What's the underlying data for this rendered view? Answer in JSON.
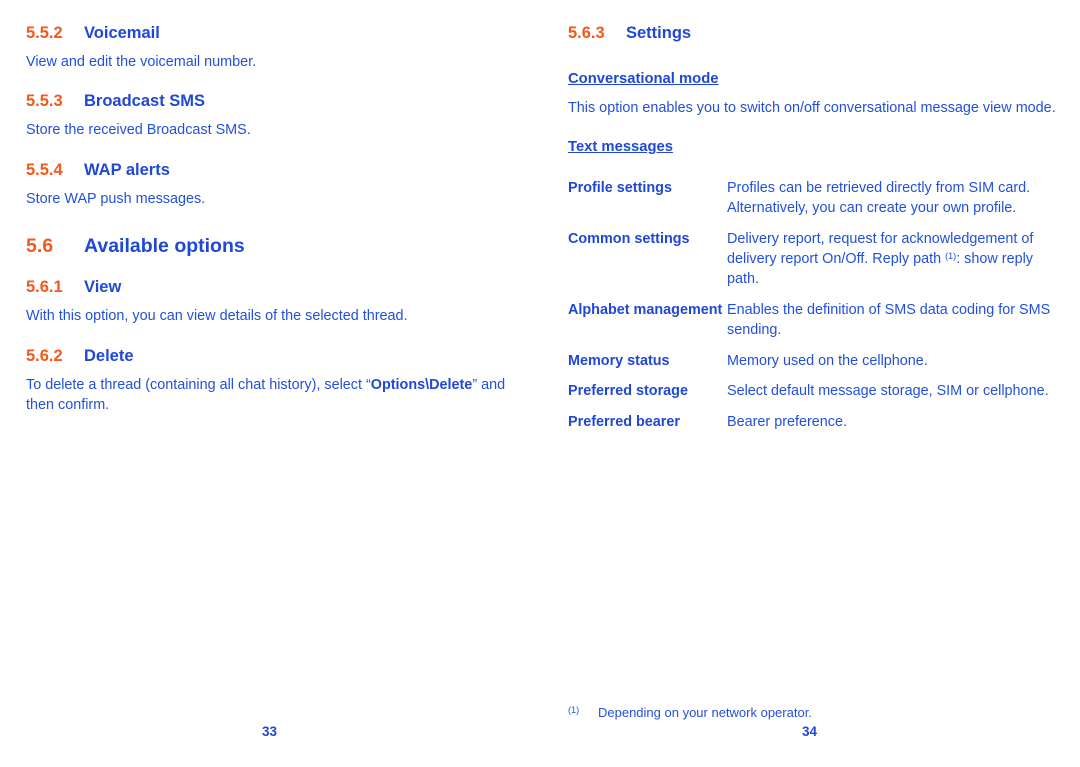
{
  "colors": {
    "number_orange": "#f4591e",
    "heading_blue": "#1f47d8",
    "body_blue": "#2250dd",
    "background": "#ffffff"
  },
  "left_page": {
    "folio": "33",
    "sections": [
      {
        "number": "5.5.2",
        "title": "Voicemail",
        "body": "View and edit the voicemail number."
      },
      {
        "number": "5.5.3",
        "title": "Broadcast SMS",
        "body": "Store the received Broadcast SMS."
      },
      {
        "number": "5.5.4",
        "title": "WAP alerts",
        "body": "Store WAP push messages."
      }
    ],
    "chapter": {
      "number": "5.6",
      "title": "Available options"
    },
    "subsections": [
      {
        "number": "5.6.1",
        "title": "View",
        "body": "With this option, you can view details of the selected thread."
      },
      {
        "number": "5.6.2",
        "title": "Delete",
        "body_before": "To delete a thread (containing all chat history), select “",
        "body_bold": "Options\\Delete",
        "body_after": "” and then confirm."
      }
    ]
  },
  "right_page": {
    "folio": "34",
    "section": {
      "number": "5.6.3",
      "title": "Settings"
    },
    "subheads": {
      "conversational_mode": "Conversational mode",
      "text_messages": "Text messages"
    },
    "conversational_body": "This option enables you to switch on/off conversational message view mode.",
    "definitions": [
      {
        "term": "Profile settings",
        "desc": "Profiles can be retrieved directly from SIM card. Alternatively, you can create your own profile."
      },
      {
        "term": "Common settings",
        "desc_before": "Delivery report, request for acknowledgement of delivery report On/Off. Reply path ",
        "footnote_marker": "(1)",
        "desc_after": ": show reply path."
      },
      {
        "term": "Alphabet management",
        "desc": "Enables the definition of SMS data coding for SMS sending."
      },
      {
        "term": "Memory status",
        "desc": "Memory used on the cellphone."
      },
      {
        "term": "Preferred storage",
        "desc": "Select default message storage, SIM or cellphone."
      },
      {
        "term": "Preferred bearer",
        "desc": "Bearer preference."
      }
    ],
    "footnote": {
      "marker": "(1)",
      "text": "Depending on your network operator."
    }
  }
}
